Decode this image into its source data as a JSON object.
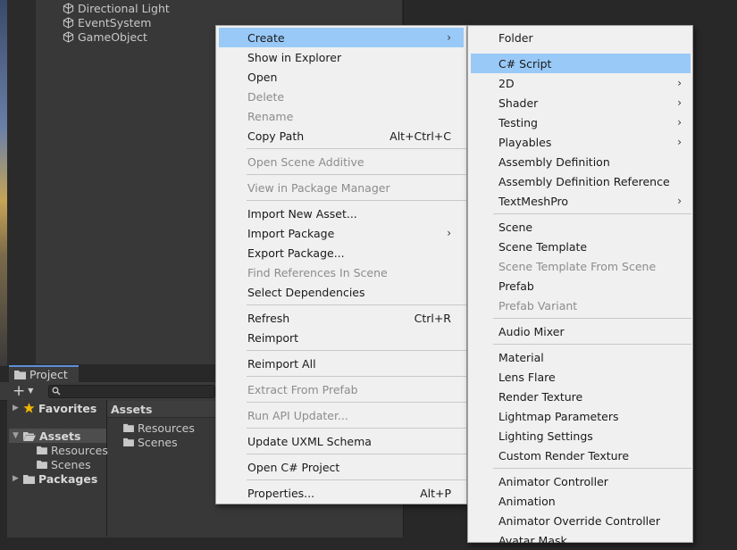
{
  "hierarchy": {
    "items": [
      "Directional Light",
      "EventSystem",
      "GameObject"
    ]
  },
  "project": {
    "tab_label": "Project",
    "add_label": "+",
    "favorites_label": "Favorites",
    "assets_label": "Assets",
    "packages_label": "Packages",
    "tree_children": [
      "Resources",
      "Scenes"
    ],
    "assets_header": "Assets",
    "folder_items": [
      "Resources",
      "Scenes"
    ]
  },
  "context_menu": {
    "items": [
      {
        "label": "Create",
        "shortcut": "",
        "submenu": true,
        "disabled": false
      },
      {
        "label": "Show in Explorer",
        "shortcut": "",
        "submenu": false,
        "disabled": false
      },
      {
        "label": "Open",
        "shortcut": "",
        "submenu": false,
        "disabled": false
      },
      {
        "label": "Delete",
        "shortcut": "",
        "submenu": false,
        "disabled": true
      },
      {
        "label": "Rename",
        "shortcut": "",
        "submenu": false,
        "disabled": true
      },
      {
        "label": "Copy Path",
        "shortcut": "Alt+Ctrl+C",
        "submenu": false,
        "disabled": false
      },
      {
        "label": "Open Scene Additive",
        "shortcut": "",
        "submenu": false,
        "disabled": true
      },
      {
        "label": "View in Package Manager",
        "shortcut": "",
        "submenu": false,
        "disabled": true
      },
      {
        "label": "Import New Asset...",
        "shortcut": "",
        "submenu": false,
        "disabled": false
      },
      {
        "label": "Import Package",
        "shortcut": "",
        "submenu": true,
        "disabled": false
      },
      {
        "label": "Export Package...",
        "shortcut": "",
        "submenu": false,
        "disabled": false
      },
      {
        "label": "Find References In Scene",
        "shortcut": "",
        "submenu": false,
        "disabled": true
      },
      {
        "label": "Select Dependencies",
        "shortcut": "",
        "submenu": false,
        "disabled": false
      },
      {
        "label": "Refresh",
        "shortcut": "Ctrl+R",
        "submenu": false,
        "disabled": false
      },
      {
        "label": "Reimport",
        "shortcut": "",
        "submenu": false,
        "disabled": false
      },
      {
        "label": "Reimport All",
        "shortcut": "",
        "submenu": false,
        "disabled": false
      },
      {
        "label": "Extract From Prefab",
        "shortcut": "",
        "submenu": false,
        "disabled": true
      },
      {
        "label": "Run API Updater...",
        "shortcut": "",
        "submenu": false,
        "disabled": true
      },
      {
        "label": "Update UXML Schema",
        "shortcut": "",
        "submenu": false,
        "disabled": false
      },
      {
        "label": "Open C# Project",
        "shortcut": "",
        "submenu": false,
        "disabled": false
      },
      {
        "label": "Properties...",
        "shortcut": "Alt+P",
        "submenu": false,
        "disabled": false
      }
    ]
  },
  "create_menu": {
    "items": [
      {
        "label": "Folder",
        "submenu": false,
        "disabled": false
      },
      {
        "label": "C# Script",
        "submenu": false,
        "disabled": false
      },
      {
        "label": "2D",
        "submenu": true,
        "disabled": false
      },
      {
        "label": "Shader",
        "submenu": true,
        "disabled": false
      },
      {
        "label": "Testing",
        "submenu": true,
        "disabled": false
      },
      {
        "label": "Playables",
        "submenu": true,
        "disabled": false
      },
      {
        "label": "Assembly Definition",
        "submenu": false,
        "disabled": false
      },
      {
        "label": "Assembly Definition Reference",
        "submenu": false,
        "disabled": false
      },
      {
        "label": "TextMeshPro",
        "submenu": true,
        "disabled": false
      },
      {
        "label": "Scene",
        "submenu": false,
        "disabled": false
      },
      {
        "label": "Scene Template",
        "submenu": false,
        "disabled": false
      },
      {
        "label": "Scene Template From Scene",
        "submenu": false,
        "disabled": true
      },
      {
        "label": "Prefab",
        "submenu": false,
        "disabled": false
      },
      {
        "label": "Prefab Variant",
        "submenu": false,
        "disabled": true
      },
      {
        "label": "Audio Mixer",
        "submenu": false,
        "disabled": false
      },
      {
        "label": "Material",
        "submenu": false,
        "disabled": false
      },
      {
        "label": "Lens Flare",
        "submenu": false,
        "disabled": false
      },
      {
        "label": "Render Texture",
        "submenu": false,
        "disabled": false
      },
      {
        "label": "Lightmap Parameters",
        "submenu": false,
        "disabled": false
      },
      {
        "label": "Lighting Settings",
        "submenu": false,
        "disabled": false
      },
      {
        "label": "Custom Render Texture",
        "submenu": false,
        "disabled": false
      },
      {
        "label": "Animator Controller",
        "submenu": false,
        "disabled": false
      },
      {
        "label": "Animation",
        "submenu": false,
        "disabled": false
      },
      {
        "label": "Animator Override Controller",
        "submenu": false,
        "disabled": false
      },
      {
        "label": "Avatar Mask",
        "submenu": false,
        "disabled": false
      }
    ]
  },
  "colors": {
    "menu_bg": "#f0f0f0",
    "highlight": "#99c9f7",
    "disabled_text": "#8c8c8c",
    "editor_bg": "#383838"
  }
}
